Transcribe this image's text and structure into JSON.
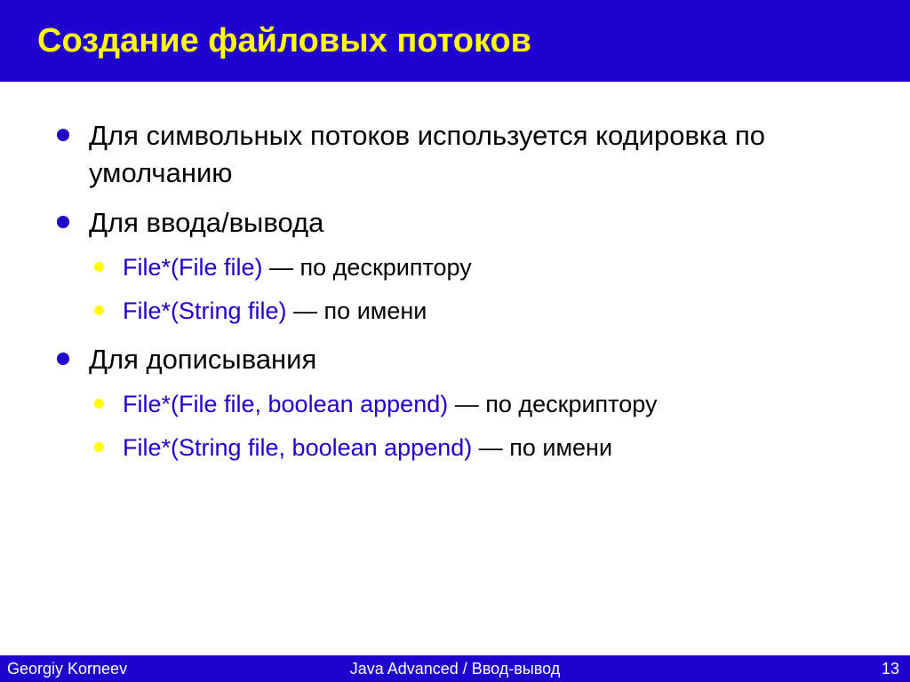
{
  "title": "Создание файловых потоков",
  "bullets": {
    "b1": "Для символьных потоков используется кодировка по умолчанию",
    "b2": "Для ввода/вывода",
    "b2_1_api": "File*(File file)",
    "b2_1_rest": " — по дескриптору",
    "b2_2_api": "File*(String file)",
    "b2_2_rest": " — по имени",
    "b3": "Для дописывания",
    "b3_1_api": "File*(File file, boolean append)",
    "b3_1_rest": " — по дескриптору",
    "b3_2_api": "File*(String file, boolean append)",
    "b3_2_rest": " — по имени"
  },
  "footer": {
    "author": "Georgiy Korneev",
    "course": "Java Advanced / Ввод-вывод",
    "page": "13"
  }
}
